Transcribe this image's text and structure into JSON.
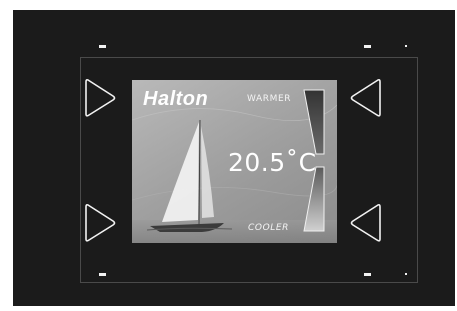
{
  "screen": {
    "brand": "Halton",
    "warmer_label": "WARMER",
    "cooler_label": "COOLER",
    "temperature": "20.5˚C"
  },
  "buttons": {
    "top_left": "right-arrow-icon",
    "bottom_left": "right-arrow-icon",
    "top_right": "left-arrow-icon",
    "bottom_right": "left-arrow-icon"
  },
  "colors": {
    "frame": "#1b1b1b",
    "screen": "#a8a8a8",
    "outline": "#f2f2f2"
  }
}
